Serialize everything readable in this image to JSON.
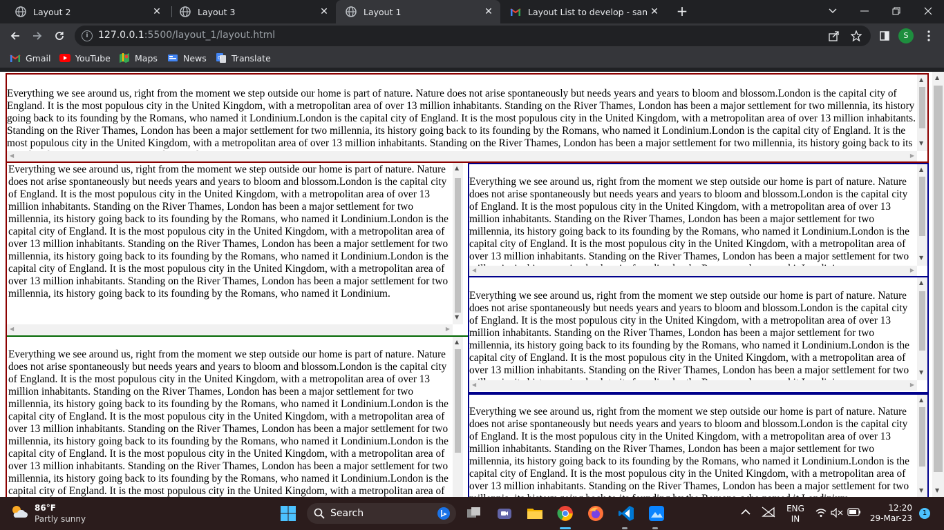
{
  "browser": {
    "tabs": [
      {
        "title": "Layout 2",
        "close": "✕",
        "active": false
      },
      {
        "title": "Layout 3",
        "close": "✕",
        "active": false
      },
      {
        "title": "Layout 1",
        "close": "✕",
        "active": true
      },
      {
        "title": "Layout List to develop - samiksha",
        "close": "✕",
        "active": false
      }
    ],
    "new_tab": "+",
    "url": {
      "host": "127.0.0.1",
      "port": ":5500",
      "path": "/layout_1/layout.html"
    },
    "profile_initial": "S",
    "bookmarks": [
      {
        "label": "Gmail",
        "icon": "gmail-icon"
      },
      {
        "label": "YouTube",
        "icon": "youtube-icon"
      },
      {
        "label": "Maps",
        "icon": "maps-icon"
      },
      {
        "label": "News",
        "icon": "news-icon"
      },
      {
        "label": "Translate",
        "icon": "translate-icon"
      }
    ]
  },
  "page": {
    "top_text": "Everything we see around us, right from the moment we step outside our home is part of nature. Nature does not arise spontaneously but needs years and years to bloom and blossom.London is the capital city of England. It is the most populous city in the United Kingdom, with a metropolitan area of over 13 million inhabitants. Standing on the River Thames, London has been a major settlement for two millennia, its history going back to its founding by the Romans, who named it Londinium.London is the capital city of England. It is the most populous city in the United Kingdom, with a metropolitan area of over 13 million inhabitants. Standing on the River Thames, London has been a major settlement for two millennia, its history going back to its founding by the Romans, who named it Londinium.London is the capital city of England. It is the most populous city in the United Kingdom, with a metropolitan area of over 13 million inhabitants. Standing on the River Thames, London has been a major settlement for two millennia, its history going back to its founding by the Romans, who named it Londinium.",
    "left_top_text": "Everything we see around us, right from the moment we step outside our home is part of nature. Nature does not arise spontaneously but needs years and years to bloom and blossom.London is the capital city of England. It is the most populous city in the United Kingdom, with a metropolitan area of over 13 million inhabitants. Standing on the River Thames, London has been a major settlement for two millennia, its history going back to its founding by the Romans, who named it Londinium.London is the capital city of England. It is the most populous city in the United Kingdom, with a metropolitan area of over 13 million inhabitants. Standing on the River Thames, London has been a major settlement for two millennia, its history going back to its founding by the Romans, who named it Londinium.London is the capital city of England. It is the most populous city in the United Kingdom, with a metropolitan area of over 13 million inhabitants. Standing on the River Thames, London has been a major settlement for two millennia, its history going back to its founding by the Romans, who named it Londinium.",
    "left_bottom_text": "Everything we see around us, right from the moment we step outside our home is part of nature. Nature does not arise spontaneously but needs years and years to bloom and blossom.London is the capital city of England. It is the most populous city in the United Kingdom, with a metropolitan area of over 13 million inhabitants. Standing on the River Thames, London has been a major settlement for two millennia, its history going back to its founding by the Romans, who named it Londinium.London is the capital city of England. It is the most populous city in the United Kingdom, with a metropolitan area of over 13 million inhabitants. Standing on the River Thames, London has been a major settlement for two millennia, its history going back to its founding by the Romans, who named it Londinium.London is the capital city of England. It is the most populous city in the United Kingdom, with a metropolitan area of over 13 million inhabitants. Standing on the River Thames, London has been a major settlement for two millennia, its history going back to its founding by the Romans, who named it Londinium.London is the capital city of England. It is the most populous city in the United Kingdom, with a metropolitan area of over 13 million inhabitants.",
    "right_text": "Everything we see around us, right from the moment we step outside our home is part of nature. Nature does not arise spontaneously but needs years and years to bloom and blossom.London is the capital city of England. It is the most populous city in the United Kingdom, with a metropolitan area of over 13 million inhabitants. Standing on the River Thames, London has been a major settlement for two millennia, its history going back to its founding by the Romans, who named it Londinium.London is the capital city of England. It is the most populous city in the United Kingdom, with a metropolitan area of over 13 million inhabitants. Standing on the River Thames, London has been a major settlement for two millennia, its history going back to its founding by the Romans, who named it Londinium."
  },
  "colors": {
    "top_border": "#8b0000",
    "left_border": "#8b0000",
    "left_divider": "#006400",
    "right_border": "#00008b"
  },
  "taskbar": {
    "weather_temp": "86°F",
    "weather_desc": "Partly sunny",
    "search_label": "Search",
    "lang_top": "ENG",
    "lang_bottom": "IN",
    "time": "12:20",
    "date": "29-Mar-23",
    "notification_count": "1"
  }
}
